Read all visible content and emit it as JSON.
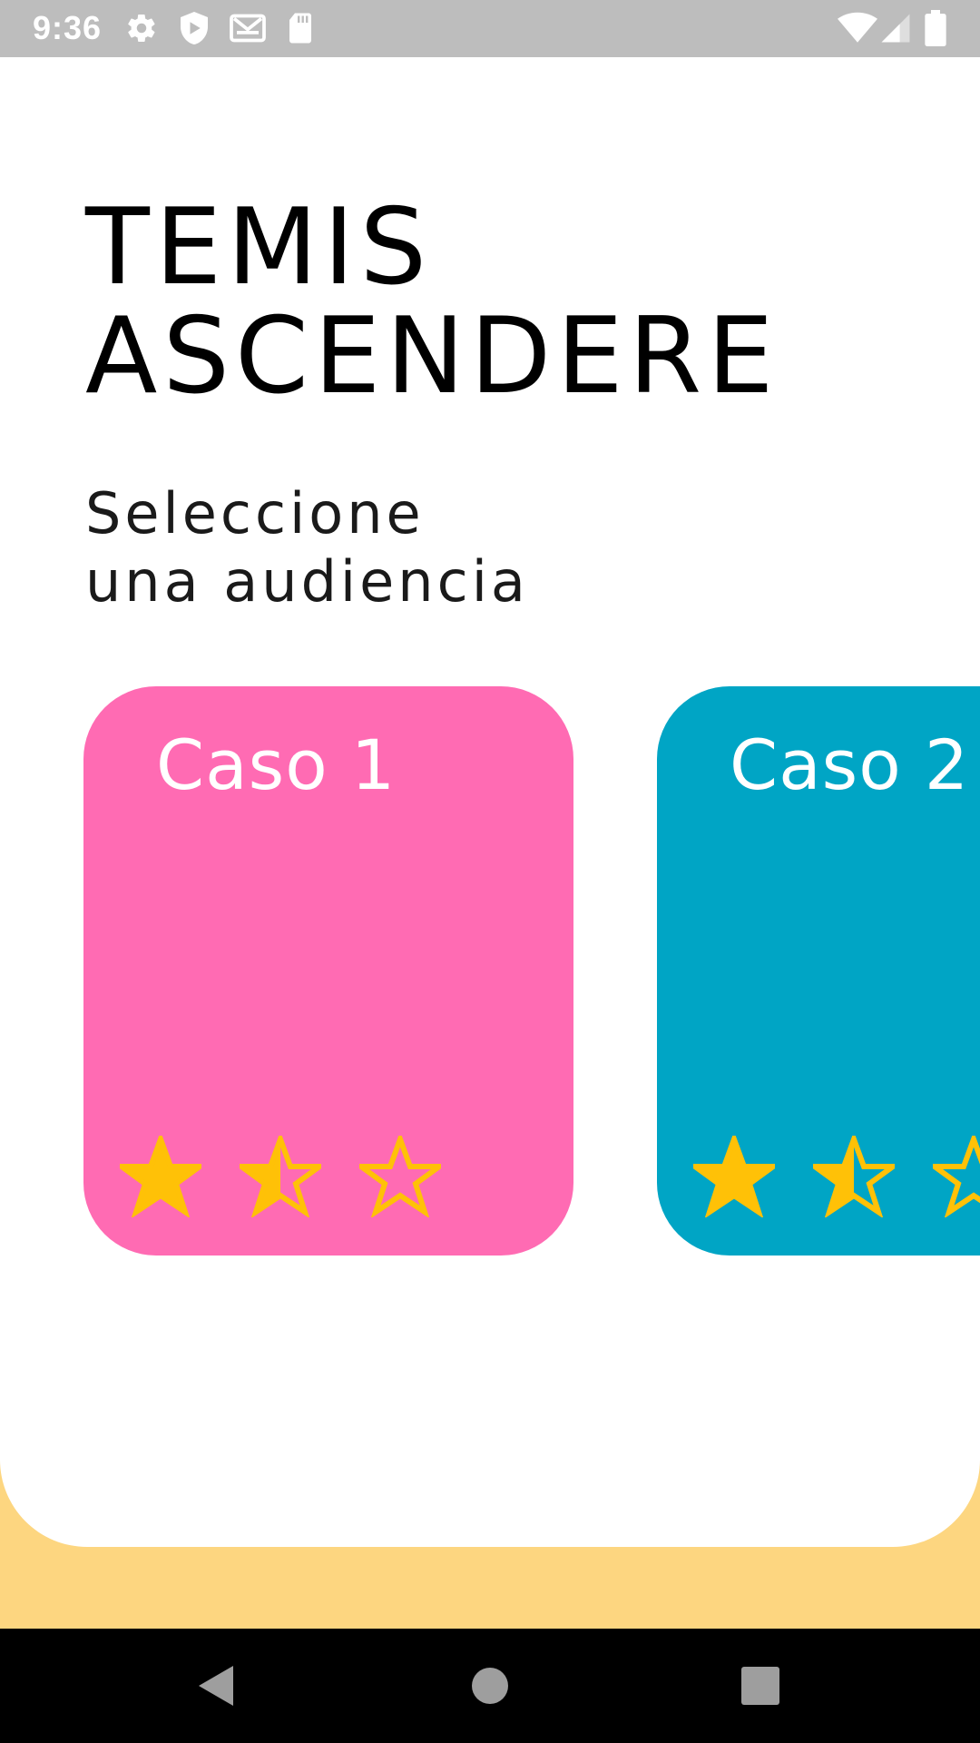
{
  "status_bar": {
    "time": "9:36",
    "icons": [
      "settings-icon",
      "shield-icon",
      "mail-icon",
      "sd-card-icon",
      "wifi-icon",
      "signal-icon",
      "battery-icon"
    ]
  },
  "header": {
    "title_line1": "TEMIS",
    "title_line2": "ASCENDERE",
    "subtitle_line1": "Seleccione",
    "subtitle_line2": "una audiencia"
  },
  "cases": [
    {
      "title": "Caso 1",
      "color": "#ff6bb3",
      "rating": 1.5,
      "rating_max": 3
    },
    {
      "title": "Caso 2",
      "color": "#00a5c5",
      "rating": 1.5,
      "rating_max": 3
    }
  ],
  "colors": {
    "background": "#fdd680",
    "panel": "#ffffff",
    "star": "#ffc107",
    "status_bar": "#bdbdbd",
    "nav_bar": "#000000"
  },
  "nav_bar": {
    "buttons": [
      "back-icon",
      "home-icon",
      "recents-icon"
    ]
  }
}
